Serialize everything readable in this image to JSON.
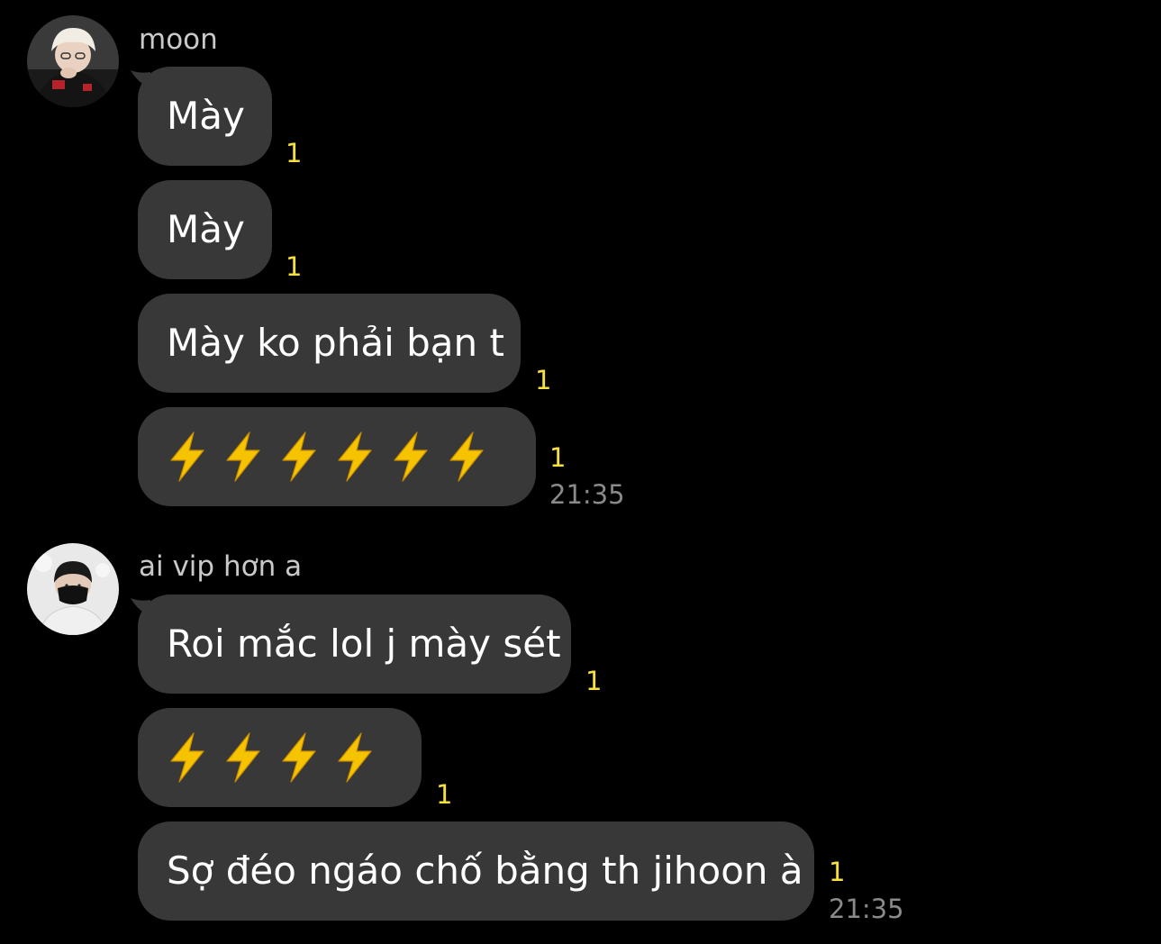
{
  "groups": [
    {
      "sender": "moon",
      "avatar_icon": "user-avatar-icon",
      "messages": [
        {
          "text": "Mày",
          "unread": "1"
        },
        {
          "text": "Mày",
          "unread": "1"
        },
        {
          "text": "Mày ko phải bạn t",
          "unread": "1"
        },
        {
          "bolts": 6,
          "icon": "lightning-bolt-icon",
          "unread": "1"
        }
      ],
      "time": "21:35"
    },
    {
      "sender": "ai vip hơn a",
      "avatar_icon": "user-avatar-icon",
      "messages": [
        {
          "text": "Roi mắc lol j mày sét",
          "unread": "1"
        },
        {
          "bolts": 4,
          "icon": "lightning-bolt-icon",
          "unread": "1"
        },
        {
          "text": "Sợ đéo ngáo chố bằng th jihoon à",
          "unread": "1"
        }
      ],
      "time": "21:35"
    }
  ],
  "colors": {
    "background": "#000000",
    "bubble": "#383838",
    "unread": "#f7df40",
    "timestamp": "#8a8a8a",
    "bolt": "#f5c300"
  }
}
